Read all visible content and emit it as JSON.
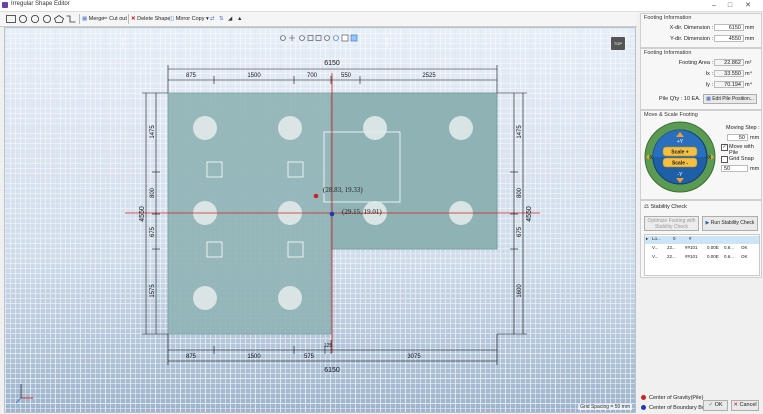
{
  "window": {
    "title": "Irregular Shape Editor",
    "min": "–",
    "max": "□",
    "close": "✕"
  },
  "toolbar": {
    "shapes": [
      "rectangle-icon",
      "circle-icon",
      "octagon-icon",
      "hexagon-icon",
      "pentagon-icon",
      "triangle-icon",
      "step-shape-icon"
    ],
    "merge": "Merge",
    "cut_out": "Cut out",
    "delete_shape": "Delete Shape",
    "mirror_copy": "Mirror Copy ▾"
  },
  "canvas": {
    "top_button": "TOP",
    "grid_spacing": "Grid Spacing = 50 mm",
    "dims": {
      "top_total": "6150",
      "top_segments": [
        "875",
        "1500",
        "700",
        "550",
        "2525"
      ],
      "bottom_total": "6150",
      "bottom_segments": [
        "875",
        "1500",
        "575",
        "3075"
      ],
      "bottom_small": "125",
      "left_total": "4550",
      "left_segments": [
        "1475",
        "800",
        "675",
        "1575"
      ],
      "right_total": "4550",
      "right_segments": [
        "1475",
        "800",
        "675",
        "1600"
      ]
    },
    "cog_label": "(28.83, 19.33)",
    "bbox_label": "(29.15, 19.01)"
  },
  "footing_info": {
    "title": "Footing Information",
    "x_label": "X-dir. Dimension :",
    "x_value": "6150",
    "x_unit": "mm",
    "y_label": "Y-dir. Dimension :",
    "y_value": "4550",
    "y_unit": "mm"
  },
  "footing_info2": {
    "title": "Footing Information",
    "area_label": "Footing Area :",
    "area_value": "22.862",
    "area_unit": "m²",
    "ix_label": "Ix :",
    "ix_value": "33.550",
    "ix_unit": "m⁴",
    "iy_label": "Iy :",
    "iy_value": "70.194",
    "iy_unit": "m⁴",
    "pile_qty": "Pile Q'ty : 10 EA.",
    "edit_pile": "Edit Pile Position..."
  },
  "move_scale": {
    "title": "Move & Scale Footing",
    "moving_step_label": "Moving Step :",
    "moving_step_value": "50",
    "moving_step_unit": "mm",
    "move_with_pile": "Move with Pile",
    "grid_snap": "Grid Snap",
    "grid_snap_value": "50",
    "grid_snap_unit": "mm",
    "plus_y": "+Y",
    "minus_y": "-Y",
    "minus_x": "-X",
    "plus_x": "+X",
    "scale_up": "Scale +",
    "scale_down": "Scale -"
  },
  "stability": {
    "title": "Stability Check",
    "optimize": "Optimize Footing with Stability Check",
    "run": "Run Stability Check",
    "rows": [
      [
        "Lo...",
        "0",
        "#",
        "",
        "",
        "",
        ""
      ],
      [
        "V...",
        "22...",
        "##101",
        "0.00E",
        "0.6...",
        "OK",
        ""
      ],
      [
        "V...",
        "22...",
        "##101",
        "0.00E",
        "0.6...",
        "OK",
        ""
      ]
    ]
  },
  "legend": {
    "cog": "Center of Gravity(Pile)",
    "bbox": "Center of Boundary Box",
    "cog_color": "#cc2222",
    "bbox_color": "#1f3bb0"
  },
  "footer": {
    "ok": "OK",
    "cancel": "Cancel"
  },
  "colors": {
    "footing_fill": "#8fb3b5",
    "pile_fill": "#e6ecec",
    "axis_red": "#d02020"
  }
}
